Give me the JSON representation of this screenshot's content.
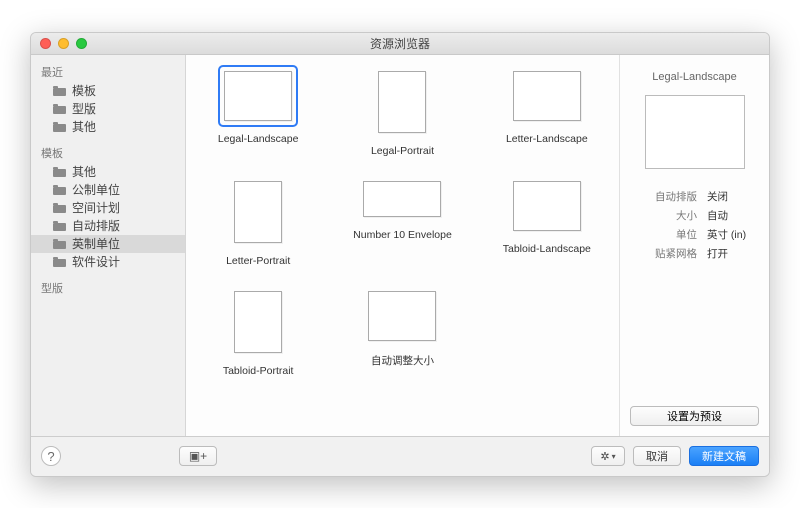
{
  "window": {
    "title": "资源浏览器"
  },
  "sidebar": {
    "sections": [
      {
        "header": "最近",
        "items": [
          {
            "label": "模板"
          },
          {
            "label": "型版"
          },
          {
            "label": "其他"
          }
        ]
      },
      {
        "header": "模板",
        "items": [
          {
            "label": "其他"
          },
          {
            "label": "公制单位"
          },
          {
            "label": "空间计划"
          },
          {
            "label": "自动排版"
          },
          {
            "label": "英制单位",
            "selected": true
          },
          {
            "label": "软件设计"
          }
        ]
      },
      {
        "header": "型版",
        "items": []
      }
    ]
  },
  "templates": [
    {
      "label": "Legal-Landscape",
      "shape": "landscape",
      "selected": true
    },
    {
      "label": "Legal-Portrait",
      "shape": "portrait"
    },
    {
      "label": "Letter-Landscape",
      "shape": "landscape"
    },
    {
      "label": "Letter-Portrait",
      "shape": "portrait"
    },
    {
      "label": "Number 10 Envelope",
      "shape": "envelope"
    },
    {
      "label": "Tabloid-Landscape",
      "shape": "landscape"
    },
    {
      "label": "Tabloid-Portrait",
      "shape": "portrait"
    },
    {
      "label": "自动调整大小",
      "shape": "landscape"
    }
  ],
  "inspector": {
    "title": "Legal-Landscape",
    "rows": [
      {
        "key": "自动排版",
        "value": "关闭"
      },
      {
        "key": "大小",
        "value": "自动"
      },
      {
        "key": "单位",
        "value": "英寸 (in)"
      },
      {
        "key": "贴紧网格",
        "value": "打开"
      }
    ],
    "preset_button": "设置为预设"
  },
  "footer": {
    "help": "?",
    "folder_add": "▣+",
    "gear": "✲",
    "cancel": "取消",
    "create": "新建文稿"
  }
}
